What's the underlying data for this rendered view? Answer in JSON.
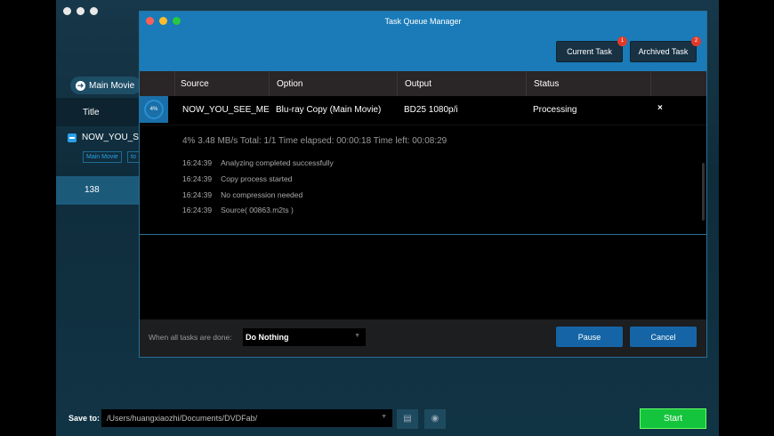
{
  "window": {
    "title": "Task Queue Manager"
  },
  "left_panel": {
    "main_movie": "Main Movie",
    "title_header": "Title",
    "title_item": "NOW_YOU_SE",
    "tags": [
      "Main Movie",
      "to"
    ],
    "row_value": "138"
  },
  "tabs": {
    "current": "Current Task",
    "current_badge": "1",
    "archived": "Archived Task",
    "archived_badge": "2"
  },
  "columns": [
    "Source",
    "Option",
    "Output",
    "Status"
  ],
  "task": {
    "progress": "4%",
    "progress_fraction": 0.04,
    "source": "NOW_YOU_SEE_ME",
    "option": "Blu-ray Copy (Main Movie)",
    "output": "BD25 1080p/i",
    "status": "Processing",
    "stats": "4%  3.48 MB/s   Total: 1/1  Time elapsed: 00:00:18  Time left: 00:08:29"
  },
  "log": [
    {
      "time": "16:24:39",
      "msg": "Analyzing completed successfully"
    },
    {
      "time": "16:24:39",
      "msg": "Copy process started"
    },
    {
      "time": "16:24:39",
      "msg": "No compression needed"
    },
    {
      "time": "16:24:39",
      "msg": "Source( 00863.m2ts )"
    }
  ],
  "bottom": {
    "when_done_label": "When all tasks are done:",
    "when_done_value": "Do Nothing",
    "pause": "Pause",
    "cancel": "Cancel"
  },
  "save": {
    "label": "Save to:",
    "path": "/Users/huangxiaozhi/Documents/DVDFab/",
    "start": "Start"
  }
}
